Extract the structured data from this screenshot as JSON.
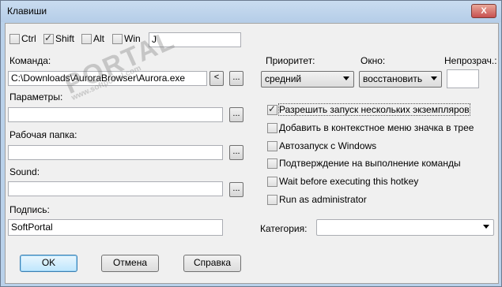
{
  "window": {
    "title": "Клавиши",
    "close_label": "X"
  },
  "modifiers": [
    {
      "label": "Ctrl",
      "checked": false
    },
    {
      "label": "Shift",
      "checked": true
    },
    {
      "label": "Alt",
      "checked": false
    },
    {
      "label": "Win",
      "checked": false
    }
  ],
  "key_value": "J",
  "command": {
    "label": "Команда:",
    "value": "C:\\Downloads\\AuroraBrowser\\Aurora.exe",
    "prev_label": "<",
    "browse_label": "..."
  },
  "params": {
    "label": "Параметры:",
    "value": "",
    "browse_label": "..."
  },
  "workdir": {
    "label": "Рабочая папка:",
    "value": "",
    "browse_label": "..."
  },
  "sound": {
    "label": "Sound:",
    "value": "",
    "browse_label": "..."
  },
  "caption": {
    "label": "Подпись:",
    "value": "SoftPortal"
  },
  "priority": {
    "label": "Приоритет:",
    "value": "средний"
  },
  "window_state": {
    "label": "Окно:",
    "value": "восстановить"
  },
  "opacity": {
    "label": "Непрозрач.:",
    "value": ""
  },
  "options": [
    {
      "label": "Разрешить запуск нескольких экземпляров",
      "checked": true
    },
    {
      "label": "Добавить в контекстное меню значка в трее",
      "checked": false
    },
    {
      "label": "Автозапуск с Windows",
      "checked": false
    },
    {
      "label": "Подтверждение на выполнение команды",
      "checked": false
    },
    {
      "label": "Wait before executing this hotkey",
      "checked": false
    },
    {
      "label": "Run as administrator",
      "checked": false
    }
  ],
  "category": {
    "label": "Категория:",
    "value": ""
  },
  "buttons": {
    "ok": "OK",
    "cancel": "Отмена",
    "help": "Справка"
  },
  "watermark": {
    "main": "PORTAL",
    "sub": "www.softportal.com"
  }
}
